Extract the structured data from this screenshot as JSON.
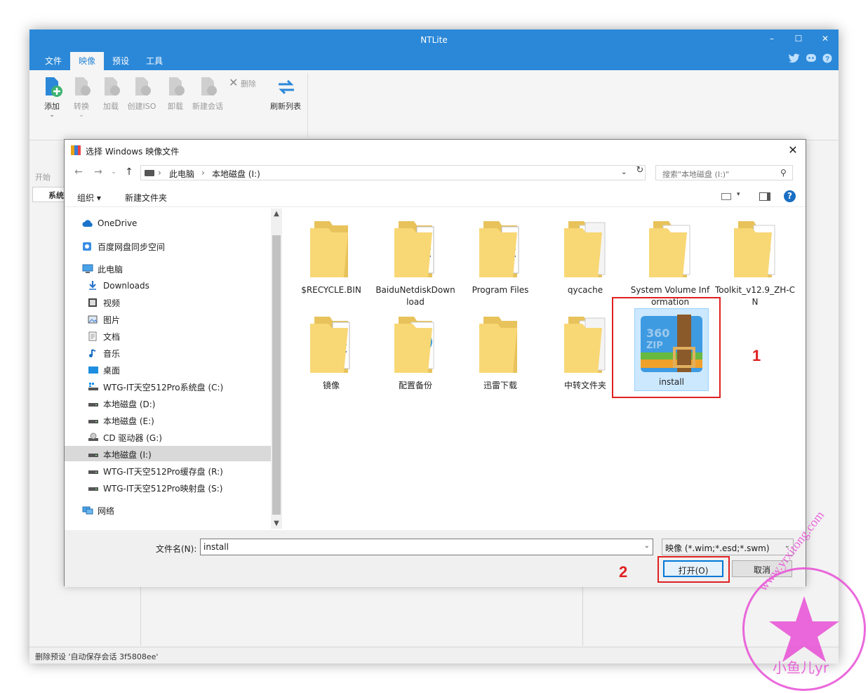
{
  "app": {
    "title": "NTLite",
    "menu": [
      "文件",
      "映像",
      "预设",
      "工具"
    ],
    "active_menu": "映像",
    "window_controls": {
      "minimize": "–",
      "maximize": "☐",
      "close": "✕"
    }
  },
  "ribbon": {
    "buttons": [
      {
        "label": "添加",
        "enabled": true
      },
      {
        "label": "转换",
        "enabled": false
      },
      {
        "label": "加载",
        "enabled": false
      },
      {
        "label": "创建ISO",
        "enabled": false
      },
      {
        "label": "卸载",
        "enabled": false
      },
      {
        "label": "新建会话",
        "enabled": false
      }
    ],
    "delete_label": "删除",
    "refresh_label": "刷新列表"
  },
  "background": {
    "start_label": "开始",
    "tab_label": "系统",
    "status": "删除预设 '自动保存会话 3f5808ee'"
  },
  "dialog": {
    "title": "选择 Windows 映像文件",
    "close": "✕",
    "breadcrumb": [
      "此电脑",
      "本地磁盘 (I:)"
    ],
    "search_placeholder": "搜索\"本地磁盘 (I:)\"",
    "toolbar": {
      "organize": "组织 ▾",
      "new_folder": "新建文件夹"
    },
    "tree": [
      {
        "label": "OneDrive",
        "icon": "cloud-icon",
        "indent": 0
      },
      {
        "label": "百度网盘同步空间",
        "icon": "baidu-icon",
        "indent": 0
      },
      {
        "label": "此电脑",
        "icon": "computer-icon",
        "indent": 0
      },
      {
        "label": "Downloads",
        "icon": "download-icon",
        "indent": 1
      },
      {
        "label": "视频",
        "icon": "video-icon",
        "indent": 1
      },
      {
        "label": "图片",
        "icon": "picture-icon",
        "indent": 1
      },
      {
        "label": "文档",
        "icon": "document-icon",
        "indent": 1
      },
      {
        "label": "音乐",
        "icon": "music-icon",
        "indent": 1
      },
      {
        "label": "桌面",
        "icon": "desktop-icon",
        "indent": 1
      },
      {
        "label": "WTG-IT天空512Pro系统盘 (C:)",
        "icon": "system-drive-icon",
        "indent": 1
      },
      {
        "label": "本地磁盘 (D:)",
        "icon": "drive-icon",
        "indent": 1
      },
      {
        "label": "本地磁盘 (E:)",
        "icon": "drive-icon",
        "indent": 1
      },
      {
        "label": "CD 驱动器 (G:)",
        "icon": "cd-drive-icon",
        "indent": 1
      },
      {
        "label": "本地磁盘 (I:)",
        "icon": "drive-icon",
        "indent": 1,
        "selected": true
      },
      {
        "label": "WTG-IT天空512Pro缓存盘 (R:)",
        "icon": "drive-icon",
        "indent": 1
      },
      {
        "label": "WTG-IT天空512Pro映射盘 (S:)",
        "icon": "drive-icon",
        "indent": 1
      },
      {
        "label": "网络",
        "icon": "network-icon",
        "indent": 0
      }
    ],
    "files": [
      {
        "name": "$RECYCLE.BIN",
        "icon": "folder-icon"
      },
      {
        "name": "BaiduNetdiskDownload",
        "icon": "folder-docs-icon"
      },
      {
        "name": "Program Files",
        "icon": "folder-docs-icon"
      },
      {
        "name": "qycache",
        "icon": "folder-pages-icon"
      },
      {
        "name": "System Volume Information",
        "icon": "folder-cd-icon"
      },
      {
        "name": "Toolkit_v12.9_ZH-CN",
        "icon": "folder-gear-icon"
      },
      {
        "name": "镜像",
        "icon": "folder-docs-icon"
      },
      {
        "name": "配置备份",
        "icon": "folder-globe-icon"
      },
      {
        "name": "迅雷下载",
        "icon": "folder-icon"
      },
      {
        "name": "中转文件夹",
        "icon": "folder-pages-icon"
      },
      {
        "name": "install",
        "icon": "360zip-archive-icon",
        "selected": true
      }
    ],
    "filename_label": "文件名(N):",
    "filename_value": "install",
    "filter_value": "映像 (*.wim;*.esd;*.swm)",
    "open_button": "打开(O)",
    "cancel_button": "取消"
  },
  "annotations": {
    "one": "1",
    "two": "2"
  },
  "watermark": {
    "url": "www.yrxitong.com",
    "cn": "小鱼儿yr"
  },
  "colors": {
    "accent": "#2b88d8",
    "annotation": "#e02020",
    "watermark": "#e84fd6",
    "selection": "#cce8ff"
  }
}
